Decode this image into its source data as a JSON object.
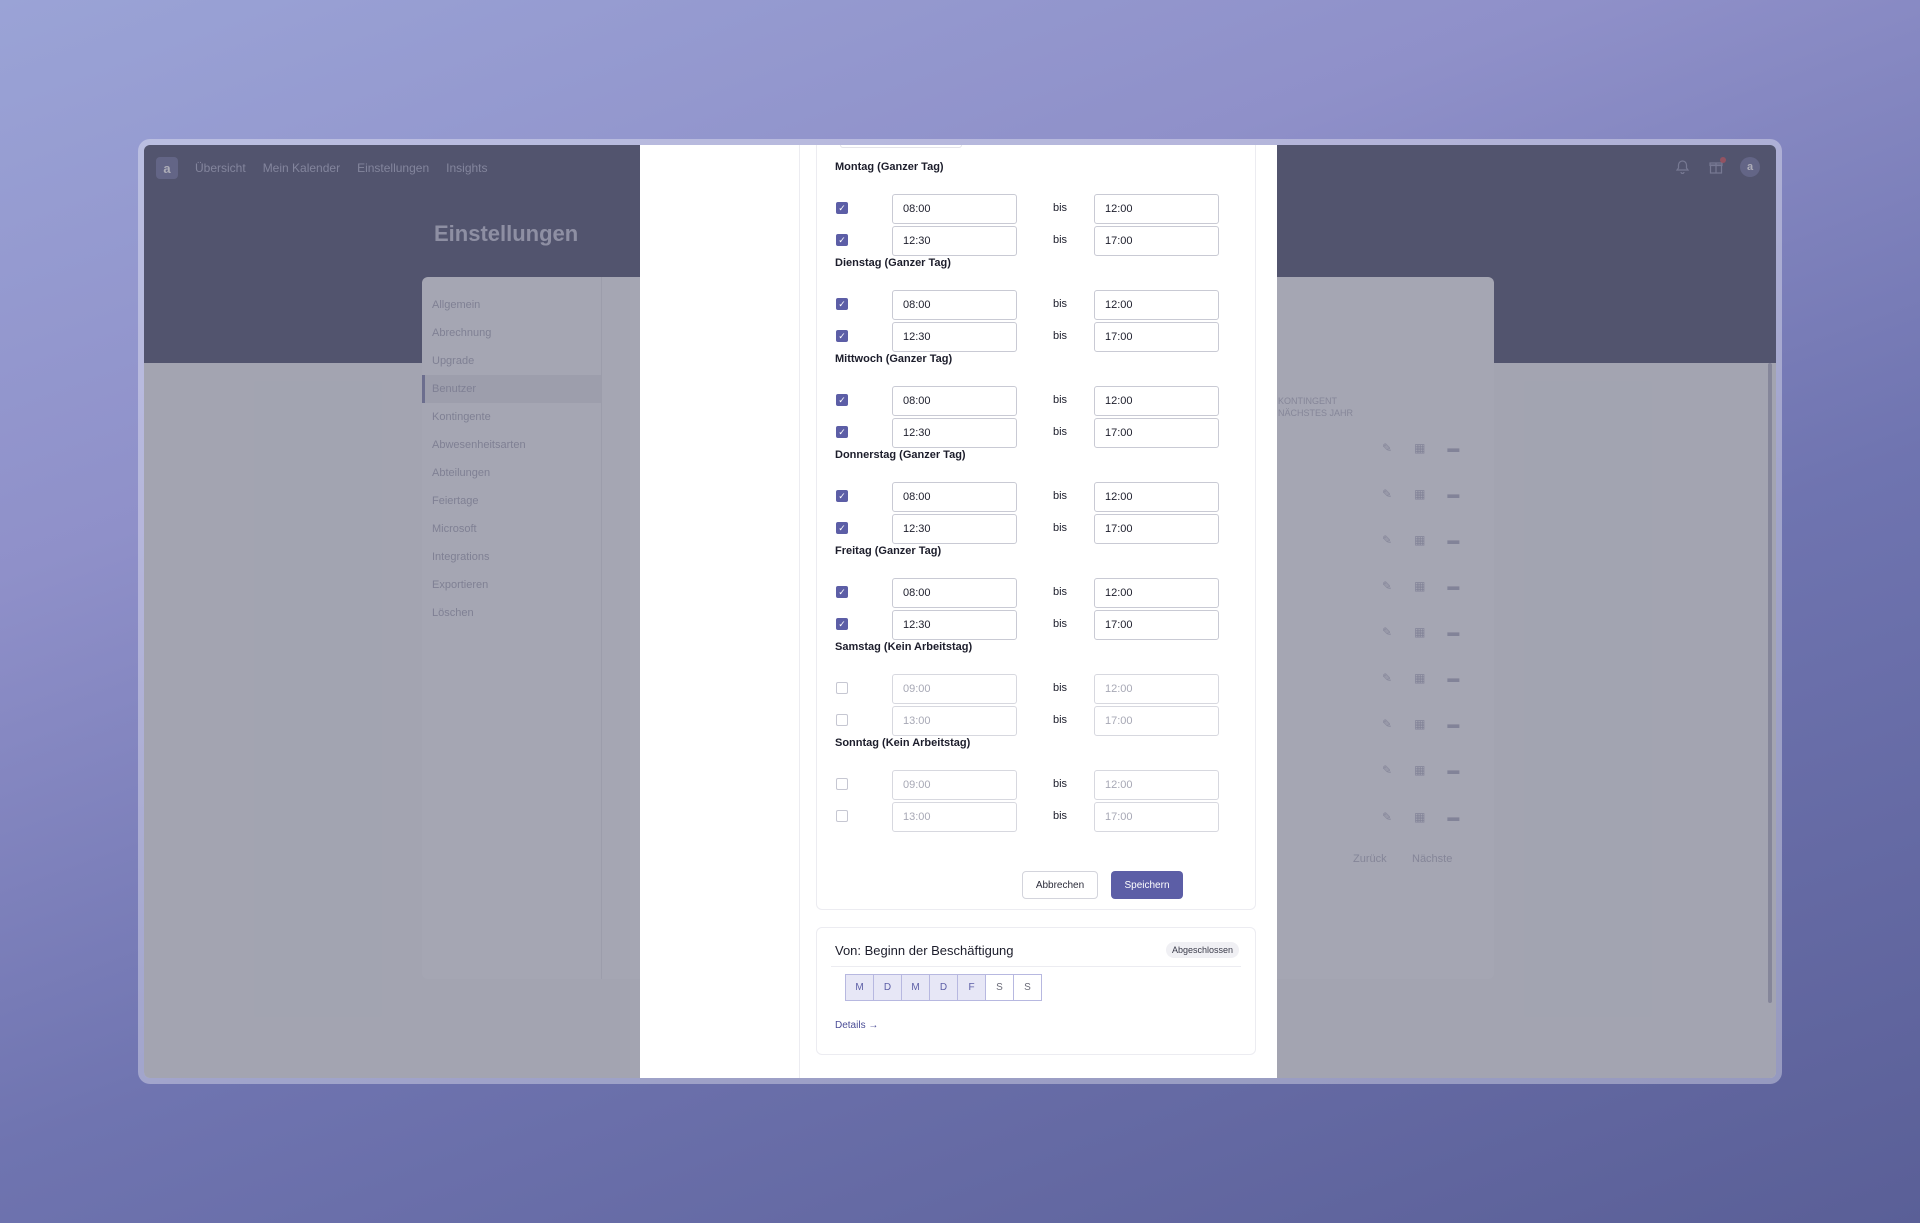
{
  "nav": {
    "logo": "a",
    "items": [
      "Übersicht",
      "Mein Kalender",
      "Einstellungen",
      "Insights"
    ]
  },
  "header_icons": [
    "bell-icon",
    "gift-icon",
    "avatar"
  ],
  "page_title": "Einstellungen",
  "settings_sidebar": [
    "Allgemein",
    "Abrechnung",
    "Upgrade",
    "Benutzer",
    "Kontingente",
    "Abwesenheitsarten",
    "Abteilungen",
    "Feiertage",
    "Microsoft",
    "Integrations",
    "Exportieren",
    "Löschen"
  ],
  "settings_sidebar_active": "Benutzer",
  "background_table": {
    "column_header_line1": "KONTINGENT",
    "column_header_line2": "NÄCHSTES JAHR",
    "pager_back": "Zurück",
    "pager_next": "Nächste"
  },
  "modal": {
    "bis_label": "bis",
    "days": [
      {
        "label": "Montag (Ganzer Tag)",
        "rows": [
          {
            "checked": true,
            "from": "08:00",
            "to": "12:00"
          },
          {
            "checked": true,
            "from": "12:30",
            "to": "17:00"
          }
        ]
      },
      {
        "label": "Dienstag (Ganzer Tag)",
        "rows": [
          {
            "checked": true,
            "from": "08:00",
            "to": "12:00"
          },
          {
            "checked": true,
            "from": "12:30",
            "to": "17:00"
          }
        ]
      },
      {
        "label": "Mittwoch (Ganzer Tag)",
        "rows": [
          {
            "checked": true,
            "from": "08:00",
            "to": "12:00"
          },
          {
            "checked": true,
            "from": "12:30",
            "to": "17:00"
          }
        ]
      },
      {
        "label": "Donnerstag (Ganzer Tag)",
        "rows": [
          {
            "checked": true,
            "from": "08:00",
            "to": "12:00"
          },
          {
            "checked": true,
            "from": "12:30",
            "to": "17:00"
          }
        ]
      },
      {
        "label": "Freitag (Ganzer Tag)",
        "rows": [
          {
            "checked": true,
            "from": "08:00",
            "to": "12:00"
          },
          {
            "checked": true,
            "from": "12:30",
            "to": "17:00"
          }
        ]
      },
      {
        "label": "Samstag (Kein Arbeitstag)",
        "rows": [
          {
            "checked": false,
            "from": "09:00",
            "to": "12:00"
          },
          {
            "checked": false,
            "from": "13:00",
            "to": "17:00"
          }
        ]
      },
      {
        "label": "Sonntag (Kein Arbeitstag)",
        "rows": [
          {
            "checked": false,
            "from": "09:00",
            "to": "12:00"
          },
          {
            "checked": false,
            "from": "13:00",
            "to": "17:00"
          }
        ]
      }
    ],
    "cancel_label": "Abbrechen",
    "save_label": "Speichern"
  },
  "schedule_card": {
    "title": "Von: Beginn der Beschäftigung",
    "badge": "Abgeschlossen",
    "weekdays": [
      {
        "letter": "M",
        "active": true
      },
      {
        "letter": "D",
        "active": true
      },
      {
        "letter": "M",
        "active": true
      },
      {
        "letter": "D",
        "active": true
      },
      {
        "letter": "F",
        "active": true
      },
      {
        "letter": "S",
        "active": false
      },
      {
        "letter": "S",
        "active": false
      }
    ],
    "details_link": "Details →"
  },
  "colors": {
    "accent": "#5c5ea6",
    "header_bg": "#5b5f7a"
  }
}
